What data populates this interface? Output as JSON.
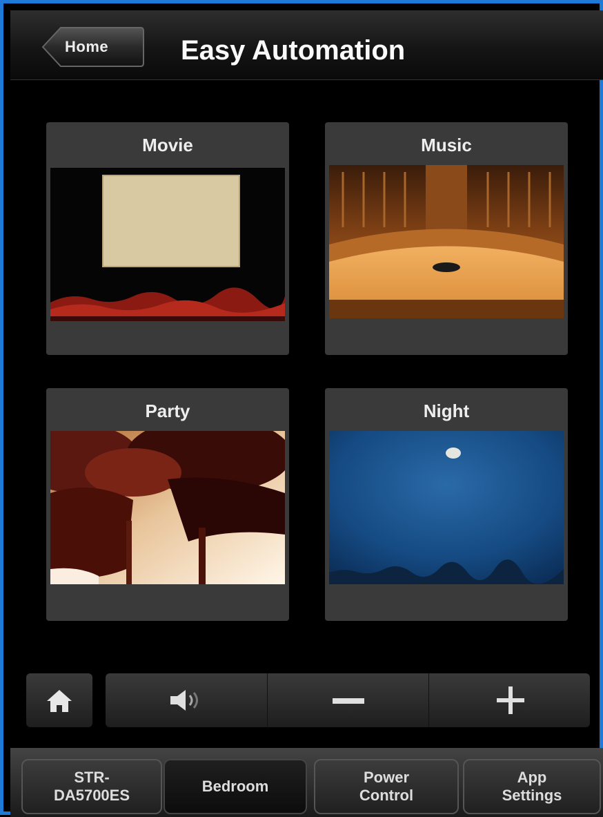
{
  "header": {
    "home_label": "Home",
    "title": "Easy Automation"
  },
  "scenes": [
    {
      "label": "Movie",
      "image_icon": "cinema-screen-image"
    },
    {
      "label": "Music",
      "image_icon": "concert-hall-image"
    },
    {
      "label": "Party",
      "image_icon": "wine-glasses-image"
    },
    {
      "label": "Night",
      "image_icon": "night-sky-moon-image"
    }
  ],
  "controls": {
    "home_icon": "home-icon",
    "mute_icon": "speaker-icon",
    "volume_down_icon": "minus-icon",
    "volume_up_icon": "plus-icon"
  },
  "tabs": [
    {
      "line1": "STR-",
      "line2": "DA5700ES"
    },
    {
      "line1": "Bedroom",
      "line2": ""
    },
    {
      "line1": "Power",
      "line2": "Control"
    },
    {
      "line1": "App",
      "line2": "Settings"
    }
  ],
  "colors": {
    "frame_border": "#1e7ad6",
    "tile_bg": "#3a3a3a",
    "background": "#000000"
  }
}
